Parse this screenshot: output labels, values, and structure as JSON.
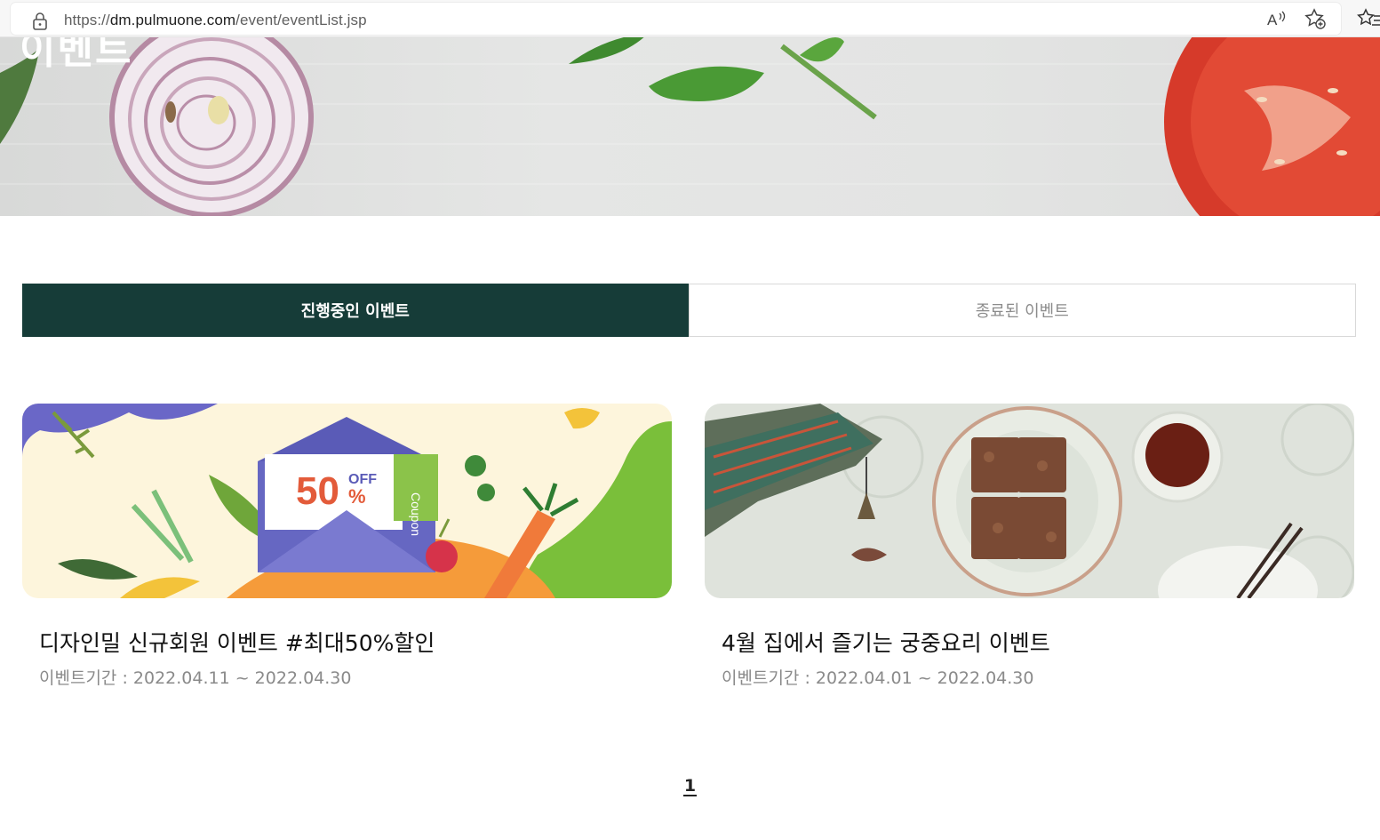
{
  "browser": {
    "url_prefix": "https://",
    "url_host": "dm.pulmuone.com",
    "url_path": "/event/eventList.jsp",
    "icons": [
      "lock-icon",
      "read-aloud-icon",
      "add-favorite-icon",
      "favorites-icon"
    ]
  },
  "hero": {
    "title": "이벤트"
  },
  "tabs": [
    {
      "label": "진행중인 이벤트",
      "active": true
    },
    {
      "label": "종료된 이벤트",
      "active": false
    }
  ],
  "events": [
    {
      "title": "디자인밀 신규회원 이벤트 #최대50%할인",
      "period_label": "이벤트기간",
      "period": "2022.04.11 ~ 2022.04.30",
      "banner": {
        "discount": "50",
        "off": "OFF",
        "percent": "%",
        "coupon": "Coupon"
      }
    },
    {
      "title": "4월 집에서 즐기는 궁중요리 이벤트",
      "period_label": "이벤트기간",
      "period": "2022.04.01 ~ 2022.04.30"
    }
  ],
  "pagination": {
    "current": "1"
  },
  "colors": {
    "tab_active_bg": "#163c38",
    "tab_active_text": "#ffffff",
    "tab_inactive_text": "#8c8c8c",
    "period_text": "#8a8a8a"
  }
}
